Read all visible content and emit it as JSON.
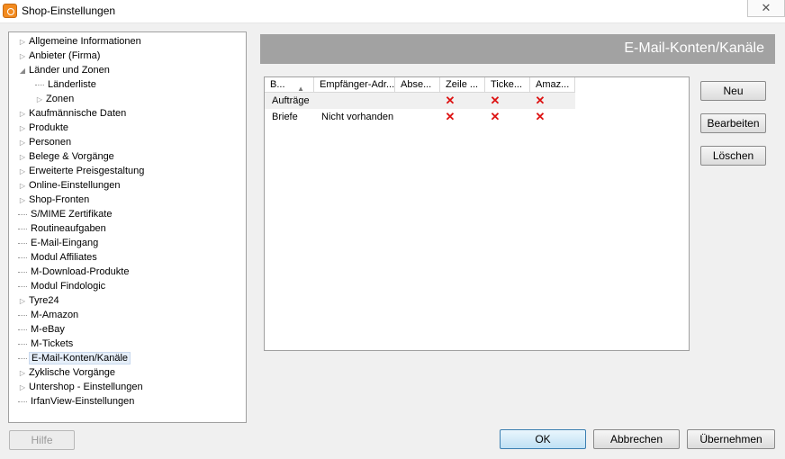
{
  "window": {
    "title": "Shop-Einstellungen",
    "close_glyph": "✕"
  },
  "header": {
    "title": "E-Mail-Konten/Kanäle"
  },
  "tree": [
    {
      "label": "Allgemeine Informationen",
      "expander": "▷",
      "level": 0
    },
    {
      "label": "Anbieter (Firma)",
      "expander": "▷",
      "level": 0
    },
    {
      "label": "Länder und Zonen",
      "expander": "◢",
      "level": 0
    },
    {
      "label": "Länderliste",
      "expander": "",
      "level": 1
    },
    {
      "label": "Zonen",
      "expander": "▷",
      "level": 1
    },
    {
      "label": "Kaufmännische Daten",
      "expander": "▷",
      "level": 0
    },
    {
      "label": "Produkte",
      "expander": "▷",
      "level": 0
    },
    {
      "label": "Personen",
      "expander": "▷",
      "level": 0
    },
    {
      "label": "Belege & Vorgänge",
      "expander": "▷",
      "level": 0
    },
    {
      "label": "Erweiterte Preisgestaltung",
      "expander": "▷",
      "level": 0
    },
    {
      "label": "Online-Einstellungen",
      "expander": "▷",
      "level": 0
    },
    {
      "label": "Shop-Fronten",
      "expander": "▷",
      "level": 0
    },
    {
      "label": "S/MIME Zertifikate",
      "expander": "",
      "level": 0
    },
    {
      "label": "Routineaufgaben",
      "expander": "",
      "level": 0
    },
    {
      "label": "E-Mail-Eingang",
      "expander": "",
      "level": 0
    },
    {
      "label": "Modul Affiliates",
      "expander": "",
      "level": 0
    },
    {
      "label": "M-Download-Produkte",
      "expander": "",
      "level": 0
    },
    {
      "label": "Modul Findologic",
      "expander": "",
      "level": 0
    },
    {
      "label": "Tyre24",
      "expander": "▷",
      "level": 0
    },
    {
      "label": "M-Amazon",
      "expander": "",
      "level": 0
    },
    {
      "label": "M-eBay",
      "expander": "",
      "level": 0
    },
    {
      "label": "M-Tickets",
      "expander": "",
      "level": 0
    },
    {
      "label": "E-Mail-Konten/Kanäle",
      "expander": "",
      "level": 0,
      "selected": true
    },
    {
      "label": "Zyklische Vorgänge",
      "expander": "▷",
      "level": 0
    },
    {
      "label": "Untershop - Einstellungen",
      "expander": "▷",
      "level": 0
    },
    {
      "label": "IrfanView-Einstellungen",
      "expander": "",
      "level": 0
    }
  ],
  "table": {
    "columns": [
      "B...",
      "Empfänger-Adr...",
      "Abse...",
      "Zeile ...",
      "Ticke...",
      "Amaz..."
    ],
    "sort_glyph": "▲",
    "rows": [
      {
        "cells": [
          "Aufträge",
          "",
          "",
          "✕",
          "✕",
          "✕"
        ]
      },
      {
        "cells": [
          "Briefe",
          "Nicht vorhanden",
          "",
          "✕",
          "✕",
          "✕"
        ]
      }
    ]
  },
  "buttons": {
    "new": "Neu",
    "edit": "Bearbeiten",
    "delete": "Löschen",
    "help": "Hilfe",
    "ok": "OK",
    "cancel": "Abbrechen",
    "apply": "Übernehmen"
  },
  "colors": {
    "accent": "#3c7fb1",
    "header_band": "#a2a2a2",
    "x_mark": "#dd1111"
  }
}
